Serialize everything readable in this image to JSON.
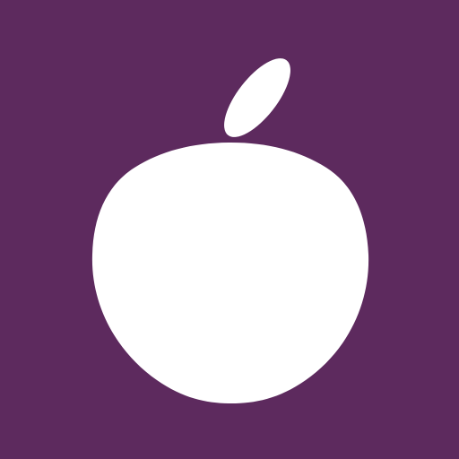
{
  "icon": {
    "name": "fruit-icon",
    "colors": {
      "background": "#5d2a5e",
      "foreground": "#ffffff"
    }
  }
}
